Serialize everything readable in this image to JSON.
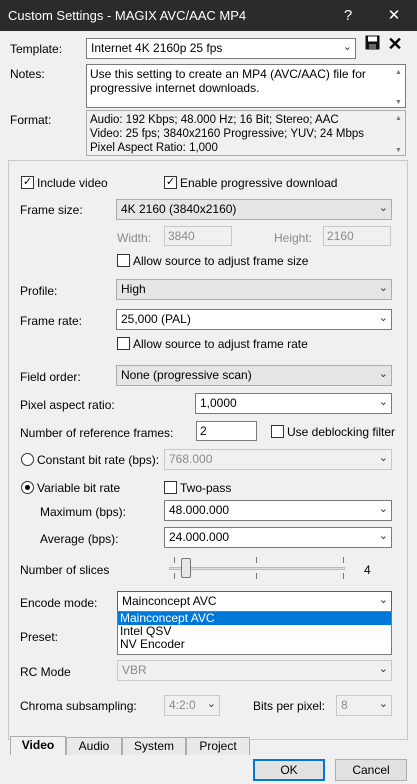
{
  "window": {
    "title": "Custom Settings - MAGIX AVC/AAC MP4",
    "help_glyph": "?",
    "close_glyph": "✕"
  },
  "template": {
    "label": "Template:",
    "value": "Internet 4K 2160p 25 fps",
    "save_icon": "save-icon",
    "delete_icon": "delete-icon"
  },
  "notes": {
    "label": "Notes:",
    "text": "Use this setting to create an MP4 (AVC/AAC) file for progressive internet downloads."
  },
  "format": {
    "label": "Format:",
    "lines": [
      "Audio: 192 Kbps; 48.000 Hz; 16 Bit; Stereo; AAC",
      "Video: 25 fps; 3840x2160 Progressive; YUV; 24 Mbps",
      "Pixel Aspect Ratio: 1,000"
    ]
  },
  "video": {
    "include_video": {
      "label": "Include video",
      "checked": true
    },
    "progressive_download": {
      "label": "Enable progressive download",
      "checked": true
    },
    "frame_size": {
      "label": "Frame size:",
      "value": "4K 2160 (3840x2160)"
    },
    "width": {
      "label": "Width:",
      "value": "3840"
    },
    "height": {
      "label": "Height:",
      "value": "2160"
    },
    "allow_frame_size": {
      "label": "Allow source to adjust frame size",
      "checked": false
    },
    "profile": {
      "label": "Profile:",
      "value": "High"
    },
    "frame_rate": {
      "label": "Frame rate:",
      "value": "25,000 (PAL)"
    },
    "allow_frame_rate": {
      "label": "Allow source to adjust frame rate",
      "checked": false
    },
    "field_order": {
      "label": "Field order:",
      "value": "None (progressive scan)"
    },
    "pixel_aspect": {
      "label": "Pixel aspect ratio:",
      "value": "1,0000"
    },
    "ref_frames": {
      "label": "Number of reference frames:",
      "value": "2"
    },
    "deblocking": {
      "label": "Use deblocking filter",
      "checked": false
    },
    "cbr": {
      "label": "Constant bit rate (bps):",
      "value": "768.000",
      "selected": false
    },
    "vbr": {
      "label": "Variable bit rate",
      "selected": true
    },
    "two_pass": {
      "label": "Two-pass",
      "checked": false
    },
    "maximum": {
      "label": "Maximum (bps):",
      "value": "48.000.000"
    },
    "average": {
      "label": "Average (bps):",
      "value": "24.000.000"
    },
    "slices": {
      "label": "Number of slices",
      "value": "4",
      "level": 0.0
    },
    "encode_mode": {
      "label": "Encode mode:",
      "value": "Mainconcept AVC",
      "options": [
        "Mainconcept AVC",
        "Intel QSV",
        "NV Encoder"
      ],
      "selected_index": 0
    },
    "preset": {
      "label": "Preset:"
    },
    "rc_mode": {
      "label": "RC Mode",
      "value": "VBR"
    },
    "chroma": {
      "label": "Chroma subsampling:",
      "value": "4:2:0"
    },
    "bits_per_pixel": {
      "label": "Bits per pixel:",
      "value": "8"
    }
  },
  "tabs": [
    "Video",
    "Audio",
    "System",
    "Project"
  ],
  "active_tab": "Video",
  "buttons": {
    "ok": "OK",
    "cancel": "Cancel"
  },
  "colors": {
    "accent": "#0078d7",
    "titlebar": "#2b2b2b"
  }
}
